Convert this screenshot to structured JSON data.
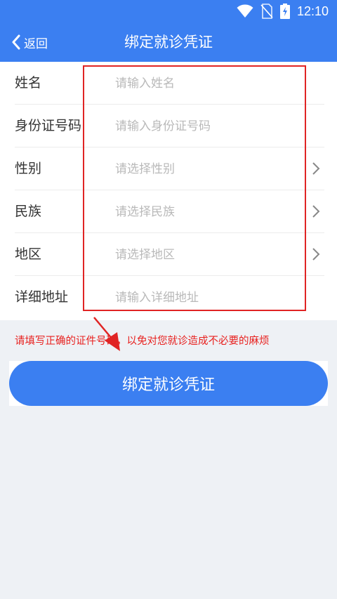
{
  "status_bar": {
    "time": "12:10",
    "icons": [
      "wifi-icon",
      "no-sim-icon",
      "battery-charging-icon"
    ]
  },
  "header": {
    "back_label": "返回",
    "title": "绑定就诊凭证",
    "color": "#3b7ff1"
  },
  "form": {
    "fields": [
      {
        "label": "姓名",
        "placeholder": "请输入姓名",
        "type": "input"
      },
      {
        "label": "身份证号码",
        "placeholder": "请输入身份证号码",
        "type": "input"
      },
      {
        "label": "性别",
        "placeholder": "请选择性别",
        "type": "select"
      },
      {
        "label": "民族",
        "placeholder": "请选择民族",
        "type": "select"
      },
      {
        "label": "地区",
        "placeholder": "请选择地区",
        "type": "select"
      },
      {
        "label": "详细地址",
        "placeholder": "请输入详细地址",
        "type": "input"
      }
    ]
  },
  "tip": {
    "text": "请填写正确的证件号码，以免对您就诊造成不必要的麻烦",
    "color": "#e8211f"
  },
  "submit": {
    "label": "绑定就诊凭证"
  },
  "annotation": {
    "color": "#e02424"
  }
}
